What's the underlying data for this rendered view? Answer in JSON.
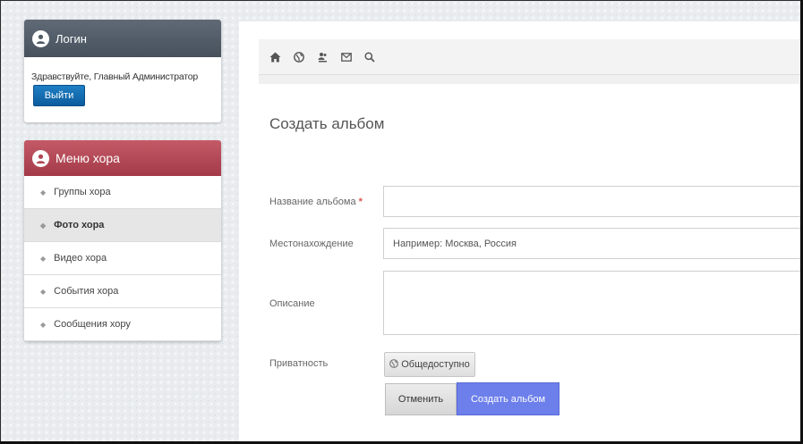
{
  "login_panel": {
    "title": "Логин",
    "greeting": "Здравствуйте, Главный Администратор",
    "logout_label": "Выйти"
  },
  "menu_panel": {
    "title": "Меню хора",
    "items": [
      {
        "label": "Группы хора",
        "active": false
      },
      {
        "label": "Фото хора",
        "active": true
      },
      {
        "label": "Видео хора",
        "active": false
      },
      {
        "label": "События хора",
        "active": false
      },
      {
        "label": "Сообщения хору",
        "active": false
      }
    ]
  },
  "toolbar": {
    "icons": [
      "home-icon",
      "globe-icon",
      "users-icon",
      "mail-icon",
      "search-icon"
    ]
  },
  "form": {
    "title": "Создать альбом",
    "album_name_label": "Название альбома",
    "required_mark": "*",
    "album_name_value": "",
    "location_label": "Местонахождение",
    "location_placeholder": "Например: Москва, Россия",
    "description_label": "Описание",
    "description_value": "",
    "privacy_label": "Приватность",
    "privacy_value": "Общедоступно",
    "cancel_label": "Отменить",
    "submit_label": "Создать альбом"
  },
  "colors": {
    "login_header": "#4f5a65",
    "menu_header": "#b04654",
    "logout_button": "#0f6cb3",
    "submit_button": "#6c7fea"
  }
}
